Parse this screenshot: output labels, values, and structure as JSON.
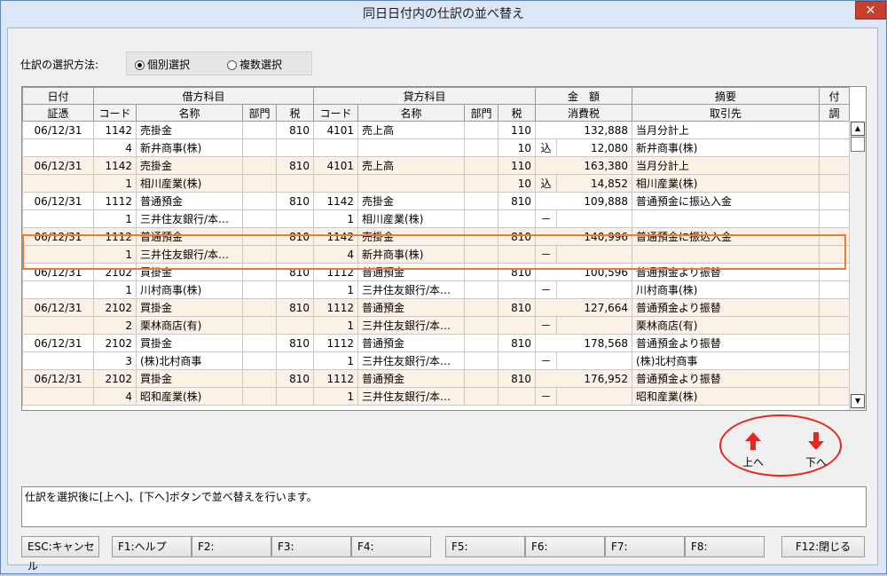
{
  "window": {
    "title": "同日日付内の仕訳の並べ替え",
    "close_label": "✕"
  },
  "selection": {
    "label": "仕訳の選択方法:",
    "options": [
      {
        "label": "個別選択",
        "selected": true
      },
      {
        "label": "複数選択",
        "selected": false
      }
    ]
  },
  "grid": {
    "header1": {
      "date": "日付",
      "debit": "借方科目",
      "credit": "貸方科目",
      "amount": "金　額",
      "summary": "摘要",
      "attach": "付"
    },
    "header2": {
      "voucher": "証憑",
      "code": "コード",
      "name": "名称",
      "dept": "部門",
      "tax": "税",
      "code2": "コード",
      "name2": "名称",
      "dept2": "部門",
      "tax2": "税",
      "cons_tax": "消費税",
      "partner": "取引先",
      "adj": "調"
    },
    "entries": [
      {
        "date": "06/12/31",
        "d_code": "1142",
        "d_name": "売掛金",
        "d_tax": "810",
        "c_code": "4101",
        "c_name": "売上高",
        "c_tax": "110",
        "amount": "132,888",
        "summary": "当月分計上",
        "d_code2": "4",
        "d_name2": "新井商事(株)",
        "c_code2": "",
        "c_name2": "",
        "c_tax2": "10",
        "tax_mark": "込",
        "tax_amount": "12,080",
        "partner": "新井商事(株)"
      },
      {
        "date": "06/12/31",
        "d_code": "1142",
        "d_name": "売掛金",
        "d_tax": "810",
        "c_code": "4101",
        "c_name": "売上高",
        "c_tax": "110",
        "amount": "163,380",
        "summary": "当月分計上",
        "d_code2": "1",
        "d_name2": "相川産業(株)",
        "c_code2": "",
        "c_name2": "",
        "c_tax2": "10",
        "tax_mark": "込",
        "tax_amount": "14,852",
        "partner": "相川産業(株)"
      },
      {
        "date": "06/12/31",
        "d_code": "1112",
        "d_name": "普通預金",
        "d_tax": "810",
        "c_code": "1142",
        "c_name": "売掛金",
        "c_tax": "810",
        "amount": "109,888",
        "summary": "普通預金に振込入金",
        "d_code2": "1",
        "d_name2": "三井住友銀行/本…",
        "c_code2": "1",
        "c_name2": "相川産業(株)",
        "c_tax2": "",
        "tax_mark": "－",
        "tax_amount": "",
        "partner": ""
      },
      {
        "date": "06/12/31",
        "d_code": "1112",
        "d_name": "普通預金",
        "d_tax": "810",
        "c_code": "1142",
        "c_name": "売掛金",
        "c_tax": "810",
        "amount": "140,996",
        "summary": "普通預金に振込入金",
        "d_code2": "1",
        "d_name2": "三井住友銀行/本…",
        "c_code2": "4",
        "c_name2": "新井商事(株)",
        "c_tax2": "",
        "tax_mark": "－",
        "tax_amount": "",
        "partner": ""
      },
      {
        "date": "06/12/31",
        "d_code": "2102",
        "d_name": "買掛金",
        "d_tax": "810",
        "c_code": "1112",
        "c_name": "普通預金",
        "c_tax": "810",
        "amount": "100,596",
        "summary": "普通預金より振替",
        "d_code2": "1",
        "d_name2": "川村商事(株)",
        "c_code2": "1",
        "c_name2": "三井住友銀行/本…",
        "c_tax2": "",
        "tax_mark": "－",
        "tax_amount": "",
        "partner": "川村商事(株)"
      },
      {
        "date": "06/12/31",
        "d_code": "2102",
        "d_name": "買掛金",
        "d_tax": "810",
        "c_code": "1112",
        "c_name": "普通預金",
        "c_tax": "810",
        "amount": "127,664",
        "summary": "普通預金より振替",
        "d_code2": "2",
        "d_name2": "栗林商店(有)",
        "c_code2": "1",
        "c_name2": "三井住友銀行/本…",
        "c_tax2": "",
        "tax_mark": "－",
        "tax_amount": "",
        "partner": "栗林商店(有)"
      },
      {
        "date": "06/12/31",
        "d_code": "2102",
        "d_name": "買掛金",
        "d_tax": "810",
        "c_code": "1112",
        "c_name": "普通預金",
        "c_tax": "810",
        "amount": "178,568",
        "summary": "普通預金より振替",
        "d_code2": "3",
        "d_name2": "(株)北村商事",
        "c_code2": "1",
        "c_name2": "三井住友銀行/本…",
        "c_tax2": "",
        "tax_mark": "－",
        "tax_amount": "",
        "partner": "(株)北村商事"
      },
      {
        "date": "06/12/31",
        "d_code": "2102",
        "d_name": "買掛金",
        "d_tax": "810",
        "c_code": "1112",
        "c_name": "普通預金",
        "c_tax": "810",
        "amount": "176,952",
        "summary": "普通預金より振替",
        "d_code2": "4",
        "d_name2": "昭和産業(株)",
        "c_code2": "1",
        "c_name2": "三井住友銀行/本…",
        "c_tax2": "",
        "tax_mark": "－",
        "tax_amount": "",
        "partner": "昭和産業(株)"
      }
    ]
  },
  "move": {
    "up_label": "上へ",
    "down_label": "下へ",
    "up_icon": "arrow-up-icon",
    "down_icon": "arrow-down-icon",
    "arrow_color": "#e8261d"
  },
  "message": "仕訳を選択後に[上へ]、[下へ]ボタンで並べ替えを行います。",
  "fkeys": {
    "esc": "ESC:キャンセル",
    "f1": "F1:ヘルプ",
    "f2": "F2:",
    "f3": "F3:",
    "f4": "F4:",
    "f5": "F5:",
    "f6": "F6:",
    "f7": "F7:",
    "f8": "F8:",
    "f12": "F12:閉じる"
  }
}
